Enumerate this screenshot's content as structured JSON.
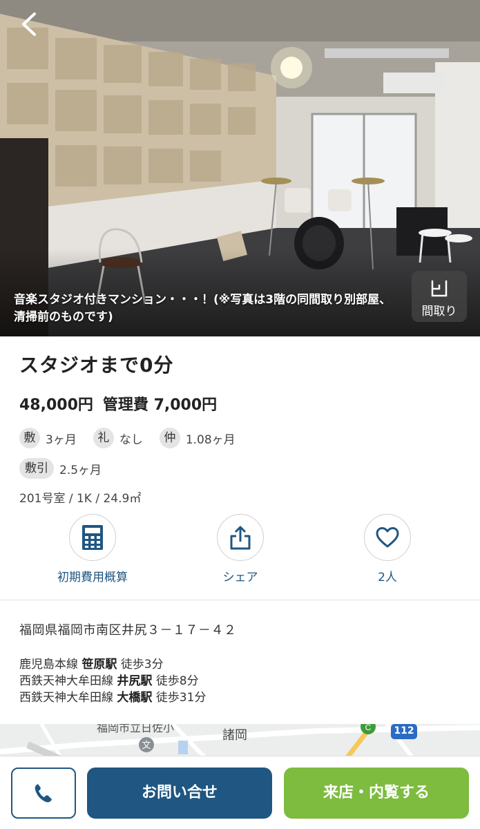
{
  "hero": {
    "caption": "音楽スタジオ付きマンション・・・！(※写真は3階の同間取り別部屋、清掃前のものです)",
    "floorplan_label": "間取り"
  },
  "listing": {
    "title": "スタジオまで0分",
    "rent": "48,000円",
    "management_fee": "管理費 7,000円",
    "fees": [
      {
        "badge": "敷",
        "value": "3ヶ月"
      },
      {
        "badge": "礼",
        "value": "なし"
      },
      {
        "badge": "仲",
        "value": "1.08ヶ月"
      }
    ],
    "deposit_deduction": {
      "badge": "敷引",
      "value": "2.5ヶ月"
    },
    "room": "201号室 / 1K / 24.9㎡"
  },
  "actions": {
    "estimate_label": "初期費用概算",
    "share_label": "シェア",
    "favorite_label": "2人"
  },
  "location": {
    "address": "福岡県福岡市南区井尻３－１７－４２",
    "stations": [
      {
        "line": "鹿児島本線",
        "station": "笹原駅",
        "walk": "徒歩3分"
      },
      {
        "line": "西鉄天神大牟田線",
        "station": "井尻駅",
        "walk": "徒歩8分"
      },
      {
        "line": "西鉄天神大牟田線",
        "station": "大橋駅",
        "walk": "徒歩31分"
      }
    ]
  },
  "map": {
    "label_city_hall": "福岡市立日佐小",
    "label_place": "諸岡",
    "route_number": "112"
  },
  "bottom": {
    "contact_label": "お問い合せ",
    "visit_label": "来店・内覧する"
  },
  "colors": {
    "primary": "#1f5682",
    "accent_green": "#7dbc3f"
  },
  "icons": {
    "back": "chevron-left-icon",
    "floorplan": "floorplan-icon",
    "calculator": "calculator-icon",
    "share": "share-icon",
    "heart": "heart-icon",
    "phone": "phone-icon"
  }
}
